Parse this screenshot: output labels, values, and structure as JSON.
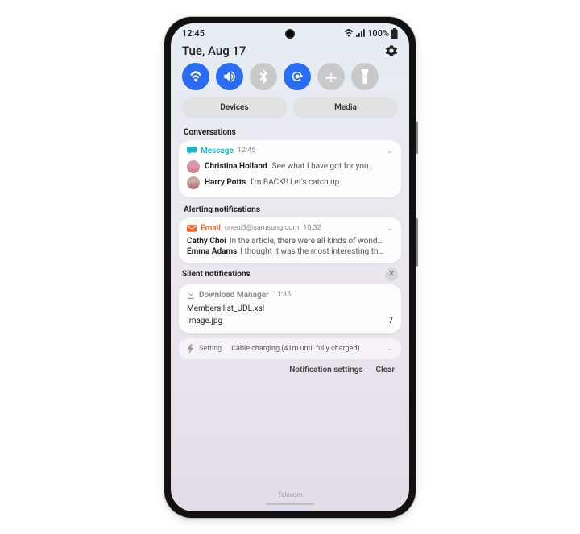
{
  "status": {
    "time": "12:45",
    "battery_pct": "100%"
  },
  "header": {
    "date": "Tue, Aug 17"
  },
  "quick_settings": [
    {
      "name": "wifi",
      "on": true
    },
    {
      "name": "sound",
      "on": true
    },
    {
      "name": "bluetooth",
      "on": false
    },
    {
      "name": "rotate",
      "on": true
    },
    {
      "name": "airplane",
      "on": false
    },
    {
      "name": "flashlight",
      "on": false
    }
  ],
  "buttons": {
    "devices": "Devices",
    "media": "Media"
  },
  "sections": {
    "conversations": "Conversations",
    "alerting": "Alerting notifications",
    "silent": "Silent notifications"
  },
  "convo": {
    "app": "Message",
    "time": "12:45",
    "items": [
      {
        "sender": "Christina Holland",
        "preview": "See what I have got for you."
      },
      {
        "sender": "Harry Potts",
        "preview": "I'm BACK!! Let's catch up."
      }
    ]
  },
  "email": {
    "app": "Email",
    "account": "oneui3@samsung.com",
    "time": "10:32",
    "items": [
      {
        "sender": "Cathy Choi",
        "preview": "In the article, there were all kinds of wond…"
      },
      {
        "sender": "Emma Adams",
        "preview": "I thought it was the most interesting th…"
      }
    ]
  },
  "download": {
    "app": "Download Manager",
    "time": "11:35",
    "files": [
      {
        "name": "Members list_UDL.xsl",
        "count": ""
      },
      {
        "name": "Image.jpg",
        "count": "7"
      }
    ]
  },
  "charging": {
    "app": "Setting",
    "text": "Cable charging (41m until fully charged)"
  },
  "footer": {
    "settings": "Notification settings",
    "clear": "Clear"
  },
  "carrier": "Telecom"
}
